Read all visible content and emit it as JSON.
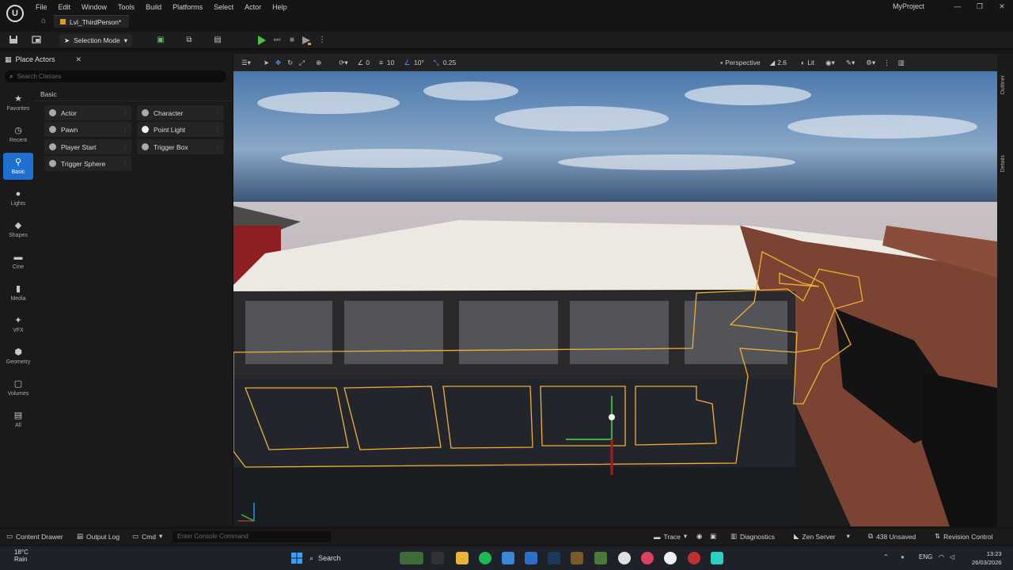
{
  "menu": [
    "File",
    "Edit",
    "Window",
    "Tools",
    "Build",
    "Platforms",
    "Select",
    "Actor",
    "Help"
  ],
  "tab": {
    "level_name": "Lvl_ThirdPerson*"
  },
  "project_name": "MyProject",
  "toolbar": {
    "mode_label": "Selection Mode"
  },
  "place_actors": {
    "title": "Place Actors",
    "search_placeholder": "Search Classes",
    "section_label": "Basic",
    "categories": [
      "Favorites",
      "Recent",
      "Basic",
      "Lights",
      "Shapes",
      "Cine",
      "Media",
      "VFX",
      "Geometry",
      "Volumes",
      "All"
    ],
    "items": [
      "Actor",
      "Character",
      "Pawn",
      "Point Light",
      "Player Start",
      "Trigger Box",
      "Trigger Sphere"
    ]
  },
  "viewport": {
    "grid_snap": "10",
    "rotation_snap": "10°",
    "scale_snap": "0.25",
    "camera_zero": "0",
    "view_mode_perspective": "Perspective",
    "camera_speed": "2.6",
    "lighting_mode": "Lit"
  },
  "side_tabs": {
    "outliner": "Outliner",
    "details": "Details"
  },
  "statusbar": {
    "content_drawer": "Content Drawer",
    "output_log": "Output Log",
    "cmd": "Cmd",
    "console_placeholder": "Enter Console Command",
    "trace": "Trace",
    "diagnostics": "Diagnostics",
    "zen_server": "Zen Server",
    "unsaved": "438 Unsaved",
    "revision_control": "Revision Control"
  },
  "taskbar": {
    "weather_temp": "18°C",
    "weather_desc": "Rain",
    "search_label": "Search",
    "lang": "ENG",
    "time": "13:23",
    "date": "26/03/2026"
  },
  "colors": {
    "accent": "#1f6fd0",
    "selection_outline": "#f0b030",
    "play_green": "#4cc24c"
  }
}
